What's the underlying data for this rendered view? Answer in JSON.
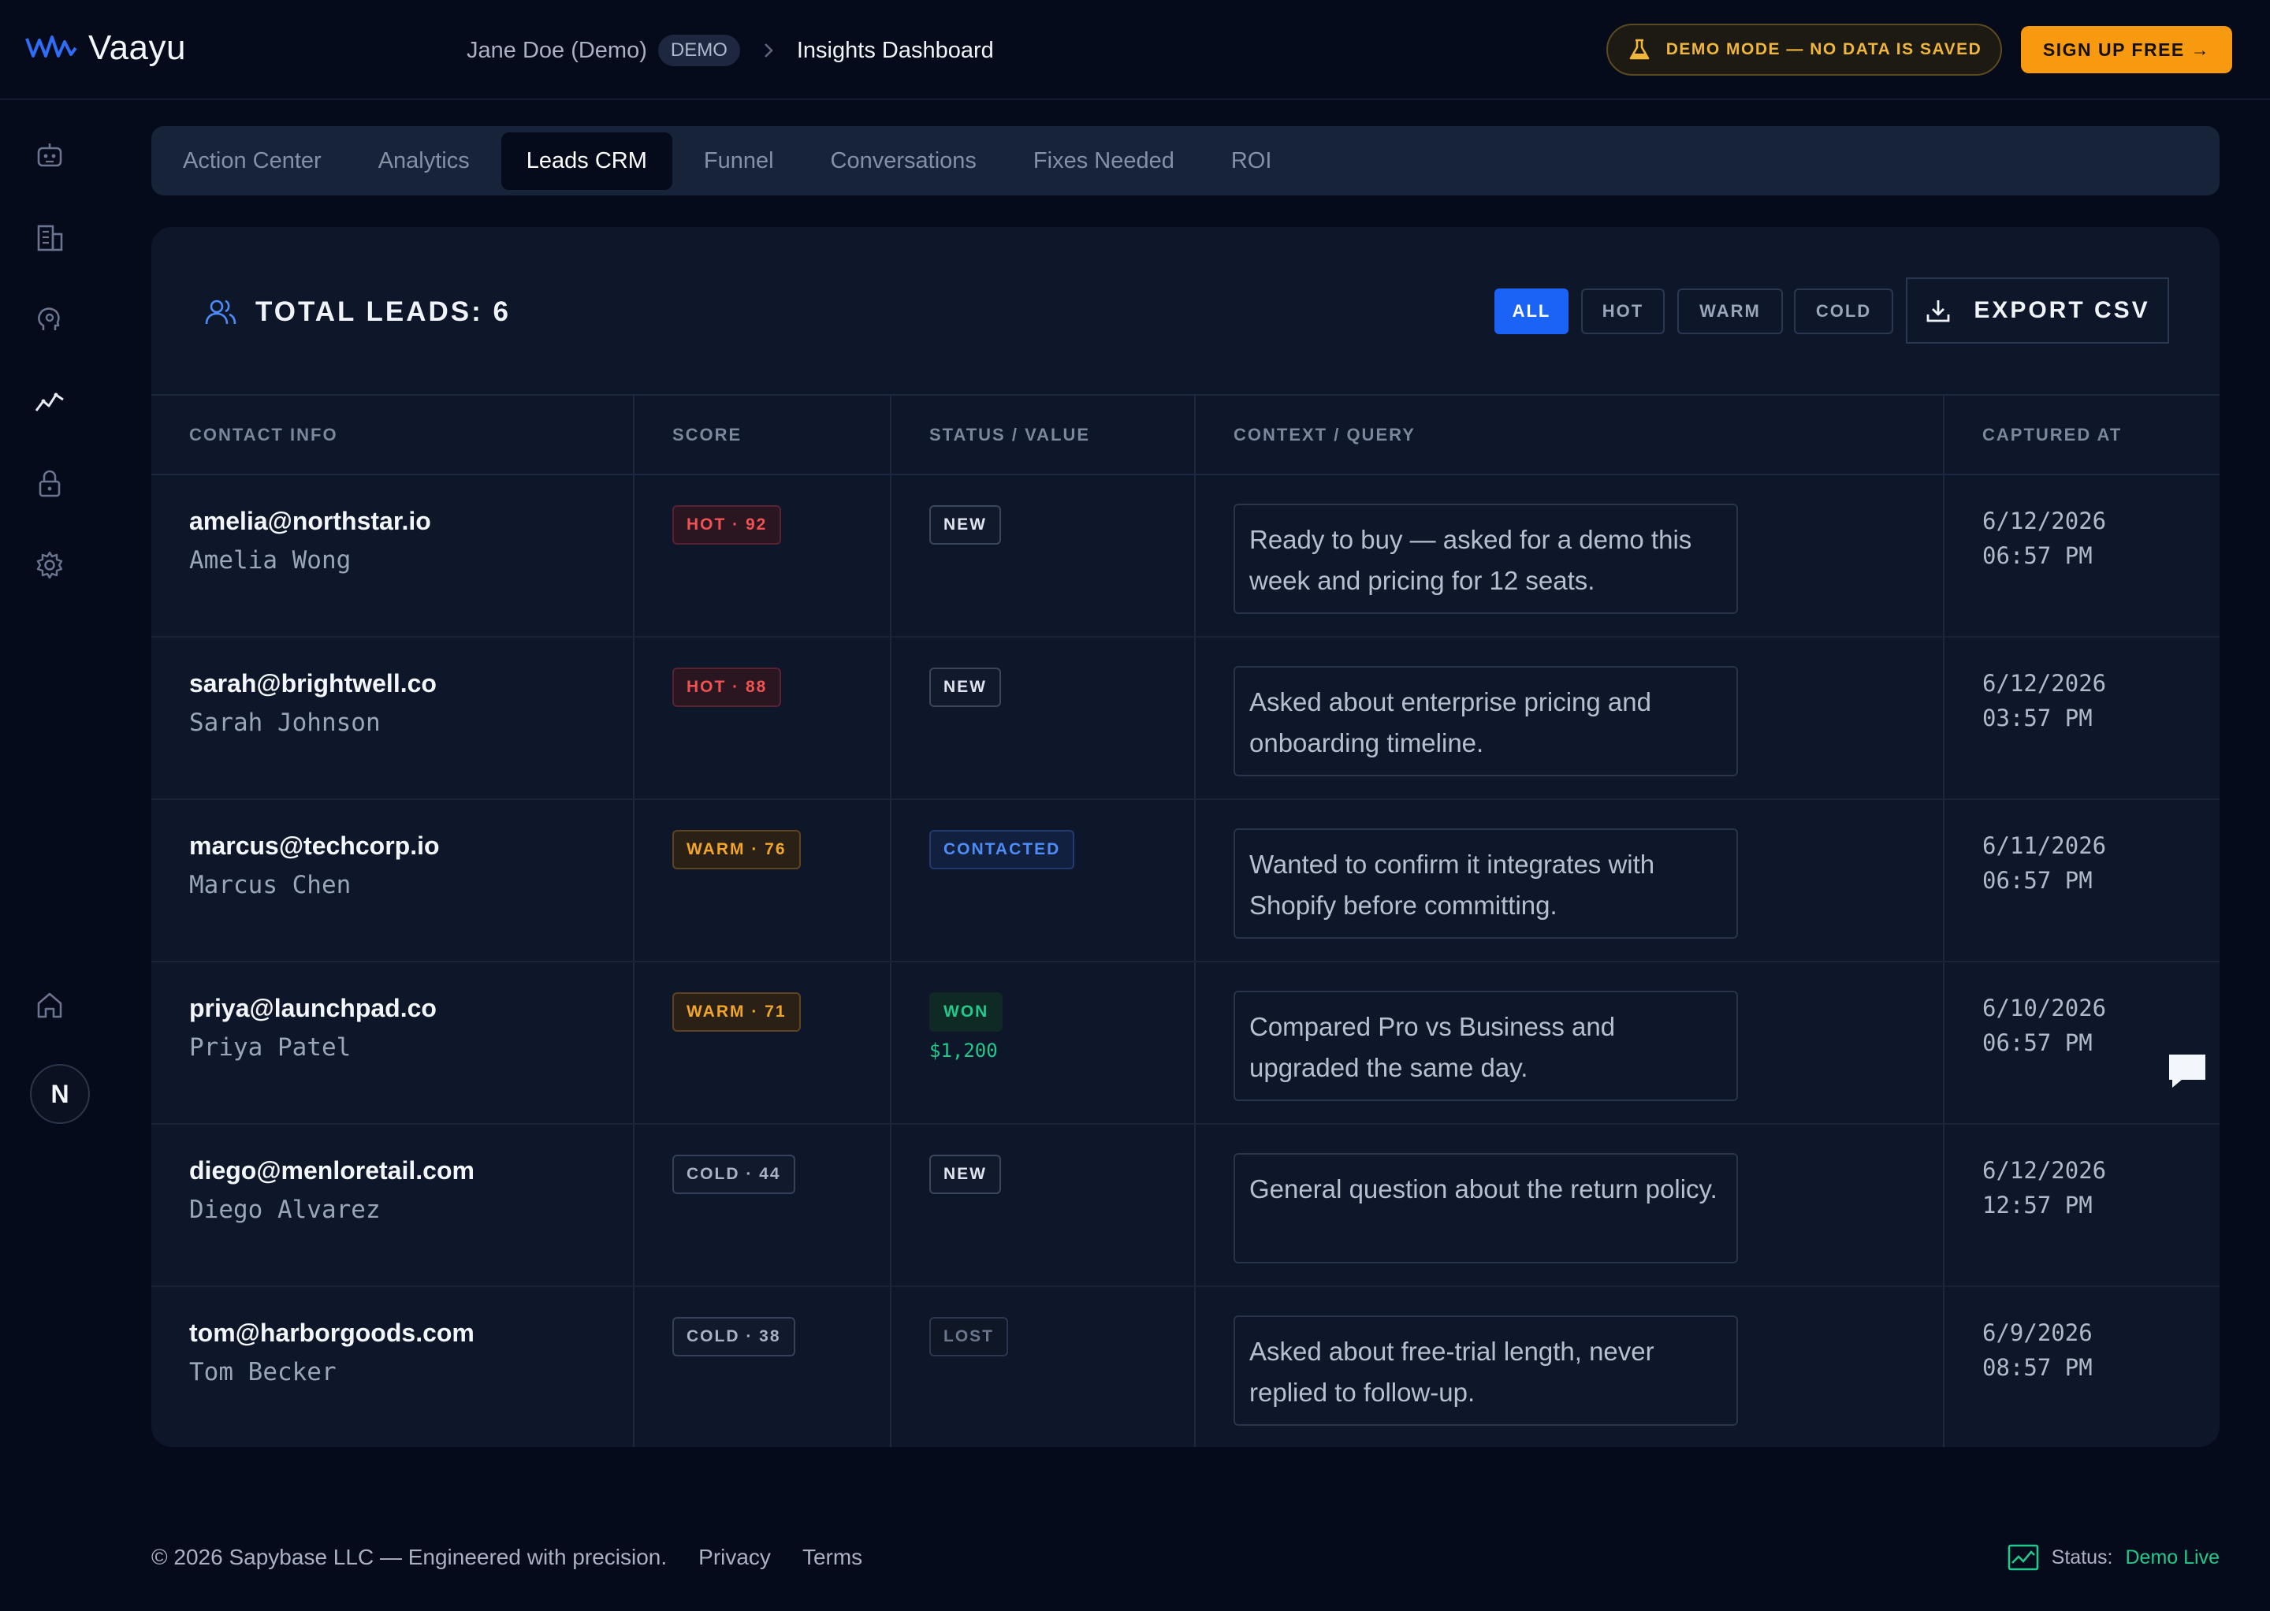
{
  "header": {
    "brand": "Vaayu",
    "user": "Jane Doe (Demo)",
    "user_badge": "DEMO",
    "page_title": "Insights Dashboard",
    "demo_mode": "DEMO MODE — NO DATA IS SAVED",
    "signup": "SIGN UP FREE →"
  },
  "sidebar": {
    "icons": [
      "bot-icon",
      "building-icon",
      "brain-icon",
      "analytics-icon",
      "lock-icon",
      "gear-icon",
      "home-icon"
    ],
    "avatar": "N"
  },
  "tabs": [
    {
      "label": "Action Center",
      "active": false
    },
    {
      "label": "Analytics",
      "active": false
    },
    {
      "label": "Leads CRM",
      "active": true
    },
    {
      "label": "Funnel",
      "active": false
    },
    {
      "label": "Conversations",
      "active": false
    },
    {
      "label": "Fixes Needed",
      "active": false
    },
    {
      "label": "ROI",
      "active": false
    }
  ],
  "leads": {
    "total_label": "TOTAL LEADS: 6",
    "filters": {
      "all": "ALL",
      "hot": "HOT",
      "warm": "WARM",
      "cold": "COLD"
    },
    "export": "EXPORT CSV",
    "columns": [
      "CONTACT INFO",
      "SCORE",
      "STATUS / VALUE",
      "CONTEXT / QUERY",
      "CAPTURED AT"
    ],
    "rows": [
      {
        "email": "amelia@northstar.io",
        "name": "Amelia Wong",
        "score": "HOT · 92",
        "score_class": "hot",
        "status": "NEW",
        "status_class": "new",
        "value": "",
        "context": "Ready to buy — asked for a demo this week and pricing for 12 seats.",
        "date": "6/12/2026",
        "time": "06:57 PM"
      },
      {
        "email": "sarah@brightwell.co",
        "name": "Sarah Johnson",
        "score": "HOT · 88",
        "score_class": "hot",
        "status": "NEW",
        "status_class": "new",
        "value": "",
        "context": "Asked about enterprise pricing and onboarding timeline.",
        "date": "6/12/2026",
        "time": "03:57 PM"
      },
      {
        "email": "marcus@techcorp.io",
        "name": "Marcus Chen",
        "score": "WARM · 76",
        "score_class": "warm",
        "status": "CONTACTED",
        "status_class": "contacted",
        "value": "",
        "context": "Wanted to confirm it integrates with Shopify before committing.",
        "date": "6/11/2026",
        "time": "06:57 PM"
      },
      {
        "email": "priya@launchpad.co",
        "name": "Priya Patel",
        "score": "WARM · 71",
        "score_class": "warm",
        "status": "WON",
        "status_class": "won",
        "value": "$1,200",
        "context": "Compared Pro vs Business and upgraded the same day.",
        "date": "6/10/2026",
        "time": "06:57 PM"
      },
      {
        "email": "diego@menloretail.com",
        "name": "Diego Alvarez",
        "score": "COLD · 44",
        "score_class": "cold",
        "status": "NEW",
        "status_class": "new",
        "value": "",
        "context": "General question about the return policy.",
        "date": "6/12/2026",
        "time": "12:57 PM"
      },
      {
        "email": "tom@harborgoods.com",
        "name": "Tom Becker",
        "score": "COLD · 38",
        "score_class": "cold",
        "status": "LOST",
        "status_class": "lost",
        "value": "",
        "context": "Asked about free-trial length, never replied to follow-up.",
        "date": "6/9/2026",
        "time": "08:57 PM"
      }
    ]
  },
  "footer": {
    "copyright": "© 2026 Sapybase LLC — Engineered with precision.",
    "privacy": "Privacy",
    "terms": "Terms",
    "status_label": "Status:",
    "status_value": "Demo Live"
  },
  "colors": {
    "background": "#050b1a",
    "accent_blue": "#1b63f5",
    "cta_orange": "#f79a10",
    "hot": "#f05252",
    "warm": "#f2a52b",
    "success": "#22c98a"
  }
}
